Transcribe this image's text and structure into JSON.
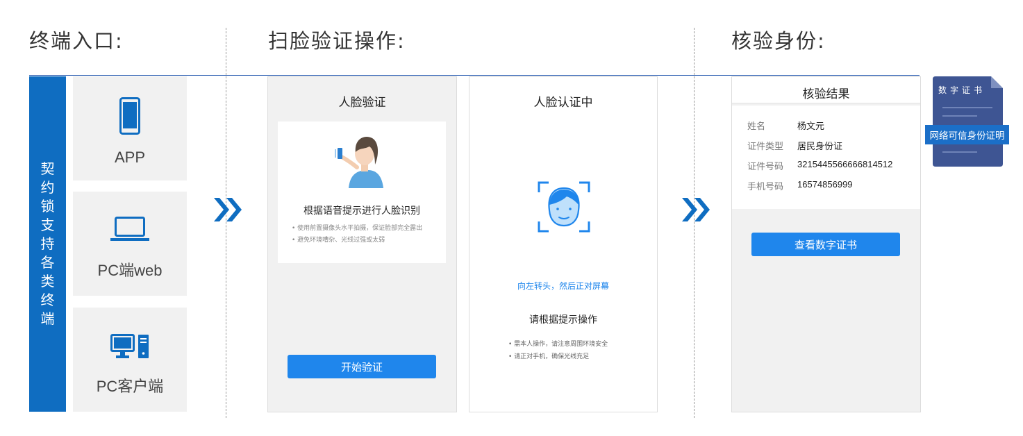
{
  "headings": {
    "terminals": "终端入口:",
    "face_verify": "扫脸验证操作:",
    "identity": "核验身份:"
  },
  "sidebar": {
    "label": "契约锁支持各类终端"
  },
  "terminals": [
    {
      "label": "APP",
      "icon": "mobile-phone-icon"
    },
    {
      "label": "PC端web",
      "icon": "laptop-icon"
    },
    {
      "label": "PC客户端",
      "icon": "desktop-computer-icon"
    }
  ],
  "face_panel": {
    "title": "人脸验证",
    "instruction": "根据语音提示进行人脸识别",
    "tips": [
      "使用前置摄像头水平拍摄，保证脸部完全露出",
      "避免环境嘈杂、光线过强或太弱"
    ],
    "button": "开始验证"
  },
  "auth_panel": {
    "title": "人脸认证中",
    "prompt": "向左转头，然后正对屏幕",
    "instruction": "请根据提示操作",
    "tips": [
      "需本人操作，请注意周围环境安全",
      "请正对手机，确保光线充足"
    ]
  },
  "result_panel": {
    "title": "核验结果",
    "fields": [
      {
        "label": "姓名",
        "value": "杨文元"
      },
      {
        "label": "证件类型",
        "value": "居民身份证"
      },
      {
        "label": "证件号码",
        "value": "3215445566666814512"
      },
      {
        "label": "手机号码",
        "value": "16574856999"
      }
    ],
    "button": "查看数字证书"
  },
  "certificate": {
    "title": "数字证书",
    "banner": "网络可信身份证明"
  },
  "colors": {
    "brand_blue": "#0f6dc1",
    "button_blue": "#1f86ec",
    "certificate_blue": "#3e5593"
  }
}
